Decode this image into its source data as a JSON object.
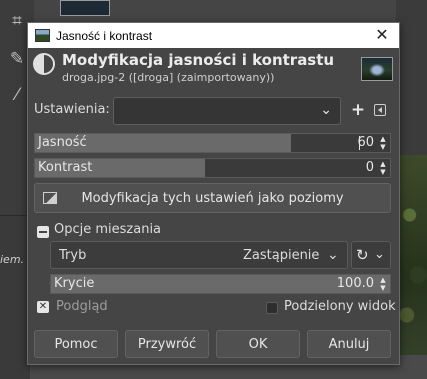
{
  "background": {
    "left_panel_text": "iem."
  },
  "dialog": {
    "window_title": "Jasność i kontrast",
    "close_label": "✕",
    "heading": "Modyfikacja jasności i kontrastu",
    "subheading": "droga.jpg-2 ([droga] (zaimportowany))",
    "presets": {
      "label": "Ustawienia:",
      "value": "",
      "add_label": "+"
    },
    "brightness": {
      "label": "Jasność",
      "value": "60",
      "fill_fraction": 0.72
    },
    "contrast": {
      "label": "Kontrast",
      "value": "0",
      "fill_fraction": 0.48
    },
    "levels_button": "Modyfikacja tych ustawień jako poziomy",
    "blending": {
      "label": "Opcje mieszania",
      "mode_label": "Tryb",
      "mode_value": "Zastąpienie",
      "opacity_label": "Krycie",
      "opacity_value": "100.0",
      "opacity_fill_fraction": 1.0
    },
    "preview": {
      "label": "Podgląd",
      "checked": true,
      "check_glyph": "✕"
    },
    "split_view": {
      "label": "Podzielony widok",
      "checked": false
    },
    "buttons": {
      "help": "Pomoc",
      "reset": "Przywróć",
      "ok": "OK",
      "cancel": "Anuluj"
    }
  },
  "colors": {
    "dialog_bg": "#454545",
    "titlebar_bg": "#ffffff",
    "slider_fill": "#6a6a6a"
  }
}
